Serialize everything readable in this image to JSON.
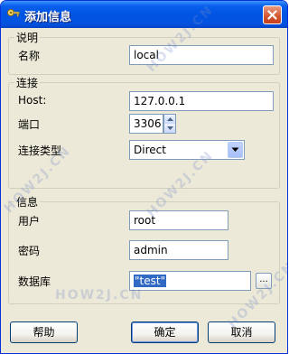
{
  "window": {
    "title": "添加信息",
    "title_icon": "key-icon",
    "close_icon": "close-icon"
  },
  "group_desc": {
    "legend": "说明",
    "name_label": "名称",
    "name_value": "local"
  },
  "group_conn": {
    "legend": "连接",
    "host_label": "Host:",
    "host_value": "127.0.0.1",
    "port_label": "端口",
    "port_value": "3306",
    "type_label": "连接类型",
    "type_value": "Direct"
  },
  "group_info": {
    "legend": "信息",
    "user_label": "用户",
    "user_value": "root",
    "password_label": "密码",
    "password_value": "admin",
    "db_label": "数据库",
    "db_value": "\"test\"",
    "browse_label": "..."
  },
  "buttons": {
    "help": "帮助",
    "ok": "确定",
    "cancel": "取消"
  },
  "watermark": {
    "text": "HOW2J.CN"
  },
  "colors": {
    "title_bar": "#0054e3",
    "dialog_bg": "#ece9d8",
    "selection": "#316ac5"
  }
}
